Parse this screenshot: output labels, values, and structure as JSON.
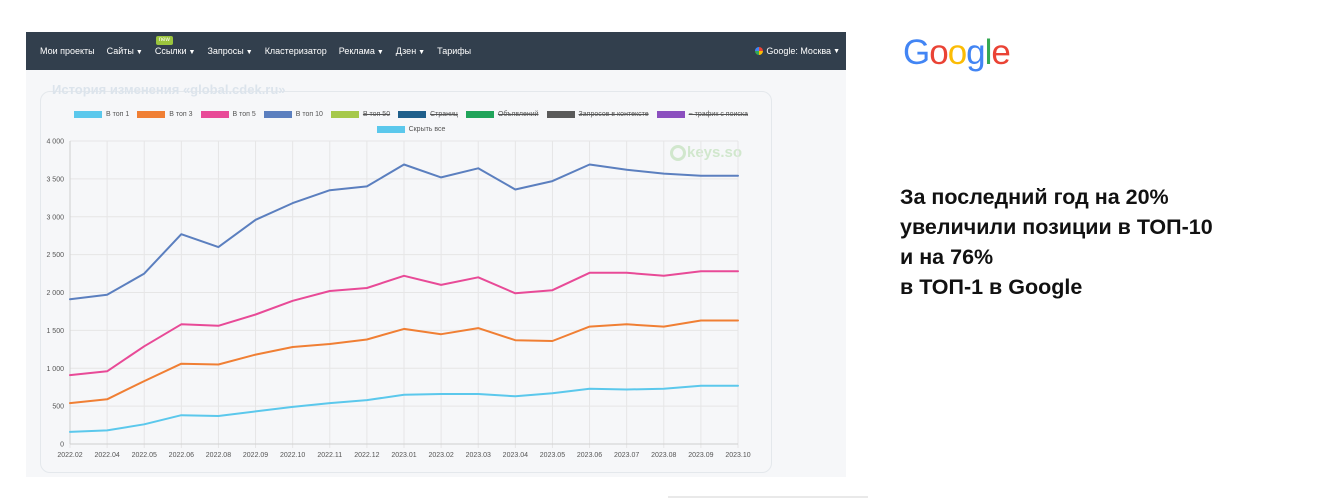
{
  "nav": {
    "items": [
      {
        "label": "Мои проекты",
        "caret": false,
        "badge": ""
      },
      {
        "label": "Сайты",
        "caret": true,
        "badge": ""
      },
      {
        "label": "Ссылки",
        "caret": true,
        "badge": "new"
      },
      {
        "label": "Запросы",
        "caret": true,
        "badge": ""
      },
      {
        "label": "Кластеризатор",
        "caret": false,
        "badge": ""
      },
      {
        "label": "Реклама",
        "caret": true,
        "badge": ""
      },
      {
        "label": "Дзен",
        "caret": true,
        "badge": ""
      },
      {
        "label": "Тарифы",
        "caret": false,
        "badge": ""
      }
    ],
    "region": "Google: Москва"
  },
  "history_title": "История изменения «global.cdek.ru»",
  "watermark": "keys.so",
  "logo": {
    "letters": [
      "G",
      "o",
      "o",
      "g",
      "l",
      "e"
    ],
    "colors": [
      "#4285f4",
      "#ea4335",
      "#fbbc05",
      "#4285f4",
      "#34a853",
      "#ea4335"
    ]
  },
  "headline": {
    "lines": [
      "За последний год на 20%",
      "увеличили позиции в ТОП-10",
      "и на 76%",
      "в ТОП-1 в Google"
    ]
  },
  "chart_data": {
    "type": "line",
    "title": "",
    "xlabel": "",
    "ylabel": "",
    "ylim": [
      0,
      4000
    ],
    "yticks": [
      0,
      500,
      1000,
      1500,
      2000,
      2500,
      3000,
      3500,
      4000
    ],
    "ytick_labels": [
      "0",
      "500",
      "1 000",
      "1 500",
      "2 000",
      "2 500",
      "3 000",
      "3 500",
      "4 000"
    ],
    "grid": true,
    "legend_position": "top",
    "x": [
      "2022.02",
      "2022.04",
      "2022.05",
      "2022.06",
      "2022.08",
      "2022.09",
      "2022.10",
      "2022.11",
      "2022.12",
      "2023.01",
      "2023.02",
      "2023.03",
      "2023.04",
      "2023.05",
      "2023.06",
      "2023.07",
      "2023.08",
      "2023.09",
      "2023.10"
    ],
    "legend": [
      {
        "name": "В топ 1",
        "color": "#5bc8ec",
        "struck": false
      },
      {
        "name": "В топ 3",
        "color": "#f07f34",
        "struck": false
      },
      {
        "name": "В топ 5",
        "color": "#e84a97",
        "struck": false
      },
      {
        "name": "В топ 10",
        "color": "#5b7fbf",
        "struck": false
      },
      {
        "name": "В топ 50",
        "color": "#a6c94a",
        "struck": true
      },
      {
        "name": "Страниц",
        "color": "#1f5f8b",
        "struck": true
      },
      {
        "name": "Объявлений",
        "color": "#20a45a",
        "struck": true
      },
      {
        "name": "Запросов в контексте",
        "color": "#5a5a5a",
        "struck": true
      },
      {
        "name": "~ трафик с поиска",
        "color": "#8b4fbf",
        "struck": true
      },
      {
        "name": "Скрыть все",
        "color": "#5bc8ec",
        "struck": false
      }
    ],
    "series": [
      {
        "name": "В топ 10",
        "color": "#5b7fbf",
        "values": [
          1910,
          1970,
          2250,
          2770,
          2600,
          2960,
          3180,
          3350,
          3400,
          3690,
          3520,
          3640,
          3360,
          3470,
          3690,
          3620,
          3570,
          3540,
          3540
        ]
      },
      {
        "name": "В топ 5",
        "color": "#e84a97",
        "values": [
          910,
          960,
          1290,
          1580,
          1560,
          1710,
          1890,
          2020,
          2060,
          2220,
          2100,
          2200,
          1990,
          2030,
          2260,
          2260,
          2220,
          2280,
          2280
        ]
      },
      {
        "name": "В топ 3",
        "color": "#f07f34",
        "values": [
          540,
          590,
          830,
          1060,
          1050,
          1180,
          1280,
          1320,
          1380,
          1520,
          1450,
          1530,
          1370,
          1360,
          1550,
          1580,
          1550,
          1630,
          1630
        ]
      },
      {
        "name": "В топ 1",
        "color": "#5bc8ec",
        "values": [
          160,
          180,
          260,
          380,
          370,
          430,
          490,
          540,
          580,
          650,
          660,
          660,
          630,
          670,
          730,
          720,
          730,
          770,
          770
        ]
      }
    ]
  }
}
